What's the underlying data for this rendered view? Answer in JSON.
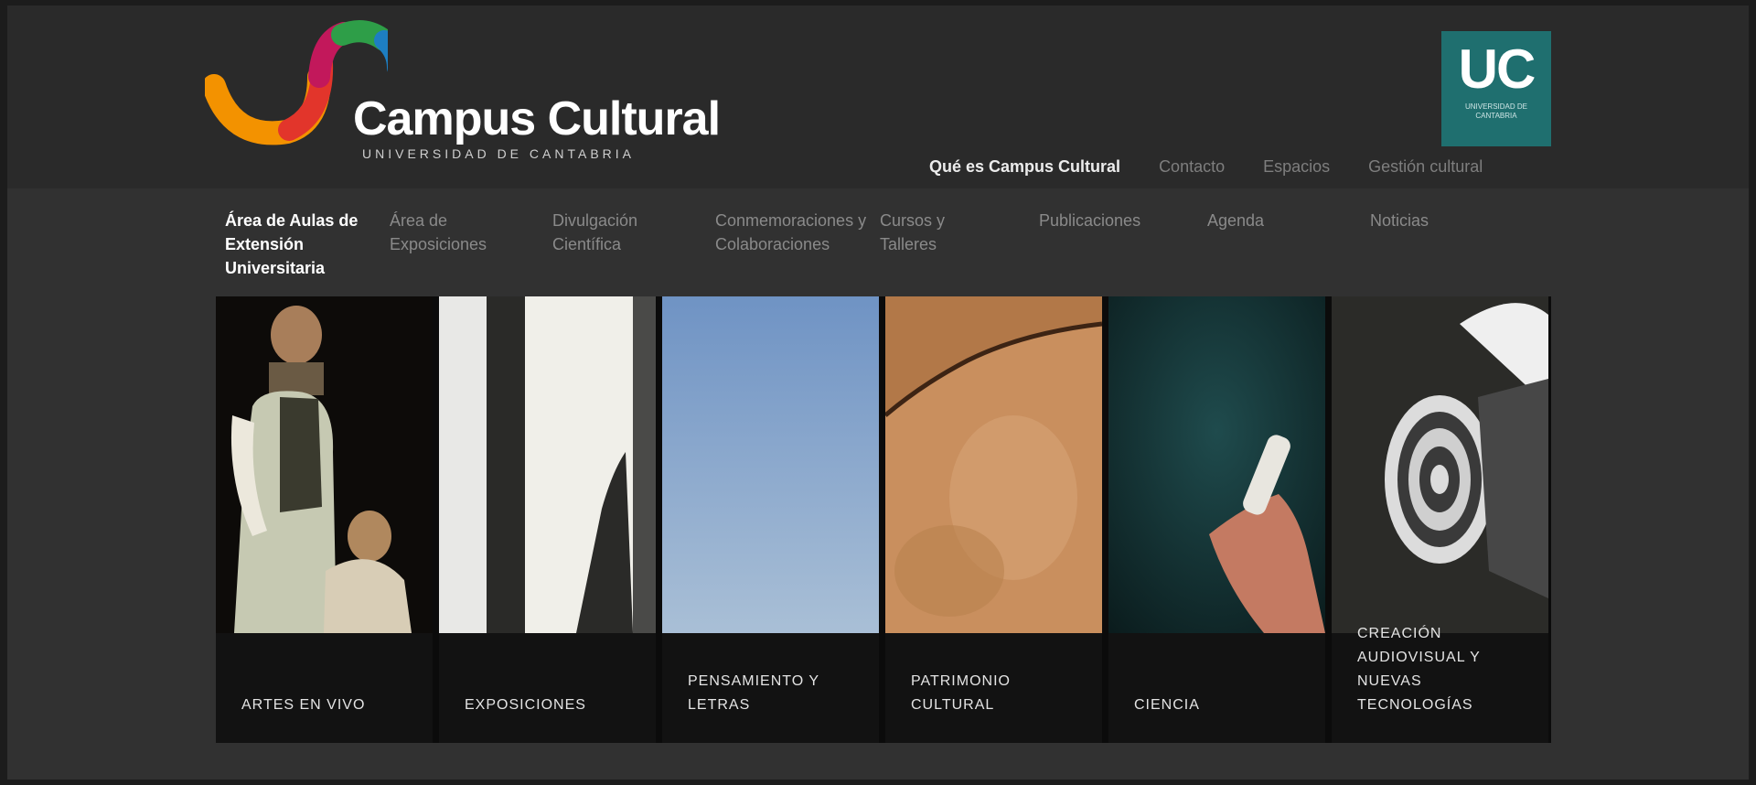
{
  "header": {
    "logo": {
      "name": "Campus Cultural",
      "subtitle": "UNIVERSIDAD DE CANTABRIA",
      "colors": [
        "#f39200",
        "#e2352b",
        "#c2185b",
        "#2e9e48",
        "#1d7ec2"
      ]
    },
    "uc_badge": {
      "text": "UC",
      "subtitle": "UNIVERSIDAD DE CANTABRIA",
      "color": "#1f6f6f"
    },
    "links": [
      {
        "label": "Qué es Campus Cultural",
        "active": true
      },
      {
        "label": "Contacto",
        "active": false
      },
      {
        "label": "Espacios",
        "active": false
      },
      {
        "label": "Gestión cultural",
        "active": false
      }
    ]
  },
  "nav": {
    "items": [
      {
        "label": "Área de Aulas de Extensión Universitaria",
        "active": true
      },
      {
        "label": "Área de Exposiciones",
        "active": false
      },
      {
        "label": "Divulgación Científica",
        "active": false
      },
      {
        "label": "Conmemoraciones y Colaboraciones",
        "active": false
      },
      {
        "label": "Cursos y Talleres",
        "active": false
      },
      {
        "label": "Publicaciones",
        "active": false
      },
      {
        "label": "Agenda",
        "active": false
      },
      {
        "label": "Noticias",
        "active": false
      }
    ]
  },
  "tiles": [
    {
      "caption": "Artes en vivo",
      "image": "painting-figure"
    },
    {
      "caption": "Exposiciones",
      "image": "white-columns"
    },
    {
      "caption": "Pensamiento y letras",
      "image": "blue-sky"
    },
    {
      "caption": "Patrimonio cultural",
      "image": "cave-rock"
    },
    {
      "caption": "Ciencia",
      "image": "hand-dark-teal"
    },
    {
      "caption": "Creación audiovisual y nuevas tecnologías",
      "image": "film-reel"
    }
  ],
  "colors": {
    "background": "#313131",
    "header": "#2a2a2a",
    "active_text": "#ffffff",
    "muted_text": "#8a8a8a"
  }
}
